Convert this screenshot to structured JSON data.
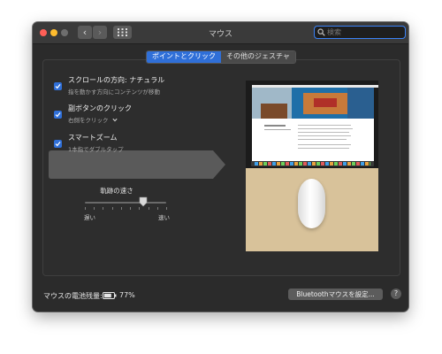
{
  "window": {
    "title": "マウス"
  },
  "search": {
    "placeholder": "検索"
  },
  "tabs": [
    {
      "label": "ポイントとクリック",
      "active": true
    },
    {
      "label": "その他のジェスチャ",
      "active": false
    }
  ],
  "options": [
    {
      "label": "スクロールの方向: ナチュラル",
      "sub": "指を動かす方向にコンテンツが移動",
      "checked": true
    },
    {
      "label": "副ボタンのクリック",
      "sub": "右側をクリック",
      "checked": true
    },
    {
      "label": "スマートズーム",
      "sub": "1本指でダブルタップ",
      "checked": true,
      "selected": true
    }
  ],
  "tracking": {
    "label": "軌跡の速さ",
    "min_label": "遅い",
    "max_label": "速い",
    "level_fraction": 0.72
  },
  "battery": {
    "label": "マウスの電池残量:",
    "value": "77%",
    "level_fraction": 0.77
  },
  "bluetooth_button": {
    "label": "Bluetoothマウスを設定..."
  },
  "help": {
    "label": "?"
  },
  "colors": {
    "accent": "#2f6fd8",
    "window_bg": "#2b2b2b",
    "selection": "#5a5a5a"
  },
  "icons": [
    "back-chevron-icon",
    "forward-chevron-icon",
    "grid-icon",
    "search-icon",
    "checkmark-icon",
    "chevron-down-icon",
    "battery-icon"
  ]
}
